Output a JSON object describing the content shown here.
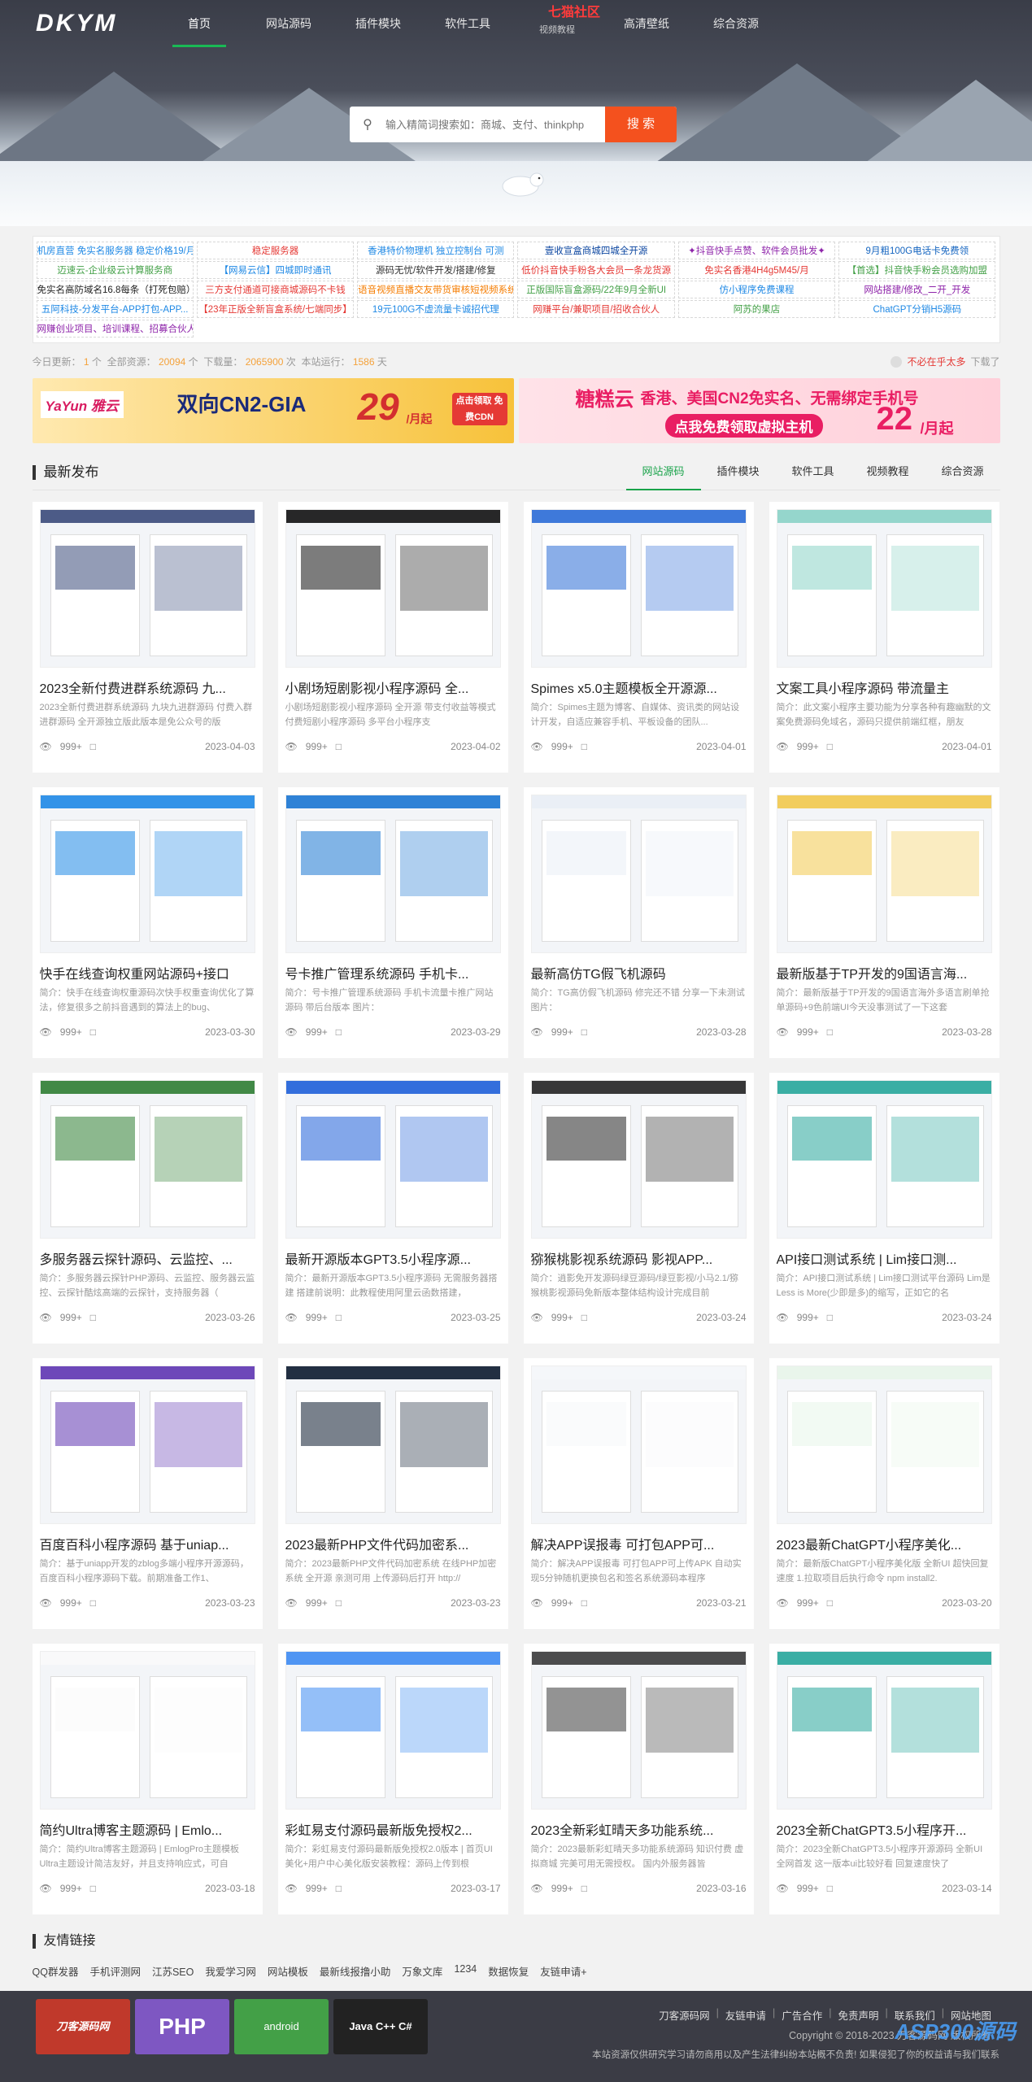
{
  "site": {
    "logo": "DKYM",
    "nav": [
      "首页",
      "网站源码",
      "插件模块",
      "软件工具",
      "视频教程",
      "高清壁纸",
      "综合资源"
    ],
    "nav_badge": "七猫社区",
    "search_placeholder": "输入精简词搜索如：商城、支付、thinkphp",
    "search_button": "搜 索"
  },
  "ads": [
    {
      "text": "机房直营 免实名服务器 稳定价格19/月",
      "color": "#1e88e5"
    },
    {
      "text": "稳定服务器",
      "color": "#e53935"
    },
    {
      "text": "香港特价物理机 独立控制台 可测",
      "color": "#1e88e5"
    },
    {
      "text": "壹收宣盒商城四城全开源",
      "color": "#0d47a1"
    },
    {
      "text": "✦抖音快手点赞、软件会员批发✦",
      "color": "#8e24aa"
    },
    {
      "text": "9月粗100G电话卡免费领",
      "color": "#1565c0"
    },
    {
      "text": "迈速云-企业级云计算服务商",
      "color": "#43a047"
    },
    {
      "text": "【网易云信】四城即时通讯",
      "color": "#1e88e5"
    },
    {
      "text": "源码无忧/软件开发/搭建/修复",
      "color": "#333333"
    },
    {
      "text": "低价抖音快手粉各大会员一条龙货源",
      "color": "#e53935"
    },
    {
      "text": "免实名香港4H4g5M45/月",
      "color": "#e53935"
    },
    {
      "text": "【首选】抖音快手粉会员选购加盟",
      "color": "#43a047"
    },
    {
      "text": "免实名高防域名16.8每条（打死包赔）",
      "color": "#222222"
    },
    {
      "text": "三方支付通道可接商城源码不卡钱",
      "color": "#e53935"
    },
    {
      "text": "语音视频直播交友带货审核短视频系统",
      "color": "#f57c00"
    },
    {
      "text": "正版国际盲盒源码/22年9月全新UI",
      "color": "#43a047"
    },
    {
      "text": "仿小程序免费课程",
      "color": "#1e88e5"
    },
    {
      "text": "网站搭建/修改_二开_开发",
      "color": "#8e24aa"
    },
    {
      "text": "五阿科技-分发平台-APP打包-APP...",
      "color": "#1e88e5"
    },
    {
      "text": "【23年正版全新盲盒系统/七端同步】",
      "color": "#e53935"
    },
    {
      "text": "19元100G不虚流量卡诚招代理",
      "color": "#1e88e5"
    },
    {
      "text": "网赚平台/兼职项目/招收合伙人",
      "color": "#e53935"
    },
    {
      "text": "阿苏的果店",
      "color": "#43a047"
    },
    {
      "text": "ChatGPT分销H5源码",
      "color": "#1e88e5"
    },
    {
      "text": "网赚创业项目、培训课程、招募合伙人",
      "color": "#8e24aa"
    }
  ],
  "stats": {
    "today_label": "今日更新：",
    "today": "1",
    "total_label": "全部资源：",
    "total": "20094",
    "downloads_label": "下载量：",
    "downloads": "2065900",
    "days_label": "本站运行：",
    "days": "1586",
    "unit_ge": "个",
    "unit_ci": "次",
    "unit_tian": "天",
    "right_text": "不必在乎太多",
    "right_suffix": "下载了"
  },
  "banners": {
    "b1_brand": "YaYun 雅云",
    "b1_title": "双向CN2-GIA",
    "b1_price": "29",
    "b1_unit": "/月起",
    "b1_tag": "点击领取 免费CDN",
    "b2_brand": "糖糕云",
    "b2_title": "香港、美国CN2免实名、无需绑定手机号",
    "b2_sub": "点我免费领取虚拟主机",
    "b2_price": "22",
    "b2_unit": "/月起"
  },
  "section": {
    "title": "最新发布",
    "tabs": [
      "网站源码",
      "插件模块",
      "软件工具",
      "视频教程",
      "综合资源"
    ]
  },
  "cards": [
    {
      "title": "2023全新付费进群系统源码 九...",
      "desc": "2023全新付费进群系统源码 九块九进群源码 付费入群进群源码 全开源独立版此版本是免公众号的版",
      "views": "999+",
      "date": "2023-04-03",
      "theme": "#3a4a7a"
    },
    {
      "title": "小剧场短剧影视小程序源码 全...",
      "desc": "小剧场短剧影视小程序源码 全开源 带支付收益等模式 付费短剧小程序源码 多平台小程序支",
      "views": "999+",
      "date": "2023-04-02",
      "theme": "#111111"
    },
    {
      "title": "Spimes x5.0主题模板全开源源...",
      "desc": "简介：Spimes主题为博客、自媒体、资讯类的网站设计开发，自适应兼容手机、平板设备的团队...",
      "views": "999+",
      "date": "2023-04-01",
      "theme": "#2a6bd6"
    },
    {
      "title": "文案工具小程序源码 带流量主",
      "desc": "简介：此文案小程序主要功能为分享各种有趣幽默的文案免费源码免域名，源码只提供前端红框，朋友",
      "views": "999+",
      "date": "2023-04-01",
      "theme": "#8bd3c7"
    },
    {
      "title": "快手在线查询权重网站源码+接口",
      "desc": "简介：快手在线查询权重源码次快手权重查询优化了算法，修复很多之前抖音遇到的算法上的bug、",
      "views": "999+",
      "date": "2023-03-30",
      "theme": "#1e88e5"
    },
    {
      "title": "号卡推广管理系统源码 手机卡...",
      "desc": "简介：号卡推广管理系统源码 手机卡流量卡推广网站源码 带后台版本 图片：",
      "views": "999+",
      "date": "2023-03-29",
      "theme": "#1976d2"
    },
    {
      "title": "最新高仿TG假飞机源码",
      "desc": "简介：TG高仿假飞机源码 修完还不错 分享一下未测试图片：",
      "views": "999+",
      "date": "2023-03-28",
      "theme": "#e9eef5"
    },
    {
      "title": "最新版基于TP开发的9国语言海...",
      "desc": "简介：最新版基于TP开发的9国语言海外多语言刷单抢单源码+9色前端UI今天没事测试了一下这套",
      "views": "999+",
      "date": "2023-03-28",
      "theme": "#f2c94c"
    },
    {
      "title": "多服务器云探针源码、云监控、...",
      "desc": "简介：多服务器云探针PHP源码、云监控、服务器云监控、云探针酷炫高端的云探针，支持服务器（",
      "views": "999+",
      "date": "2023-03-26",
      "theme": "#2e7d32"
    },
    {
      "title": "最新开源版本GPT3.5小程序源...",
      "desc": "简介：最新开源版本GPT3.5小程序源码 无需服务器搭建 搭建前说明：此教程使用阿里云函数搭建，",
      "views": "999+",
      "date": "2023-03-25",
      "theme": "#1e5fd8"
    },
    {
      "title": "猕猴桃影视系统源码 影视APP...",
      "desc": "简介：逍影免开发源码绿豆源码/绿豆影视/小马2.1/猕猴桃影视源码免新版本整体结构设计完成目前",
      "views": "999+",
      "date": "2023-03-24",
      "theme": "#222222"
    },
    {
      "title": "API接口测试系统 | Lim接口测...",
      "desc": "简介：API接口测试系统 | Lim接口测试平台源码 Lim是Less is More(少即是多)的缩写，正如它的名",
      "views": "999+",
      "date": "2023-03-24",
      "theme": "#26a69a"
    },
    {
      "title": "百度百科小程序源码 基于uniap...",
      "desc": "简介：基于uniapp开发的zblog多端小程序开源源码，百度百科小程序源码下载。前期准备工作1、",
      "views": "999+",
      "date": "2023-03-23",
      "theme": "#5e35b1"
    },
    {
      "title": "2023最新PHP文件代码加密系...",
      "desc": "简介：2023最新PHP文件代码加密系统 在线PHP加密系统 全开源 亲测可用 上传源码后打开 http://",
      "views": "999+",
      "date": "2023-03-23",
      "theme": "#0b1a2e"
    },
    {
      "title": "解决APP误报毒 可打包APP可...",
      "desc": "简介：解决APP误报毒 可打包APP可上传APK 自动实现5分钟随机更换包名和签名系统源码本程序",
      "views": "999+",
      "date": "2023-03-21",
      "theme": "#f5f7fa"
    },
    {
      "title": "2023最新ChatGPT小程序美化...",
      "desc": "简介：最新版ChatGPT小程序美化版 全新UI 超快回复速度 1.拉取项目后执行命令 npm install2.",
      "views": "999+",
      "date": "2023-03-20",
      "theme": "#e8f5e9"
    },
    {
      "title": "简约Ultra博客主题源码 | Emlo...",
      "desc": "简介：简约Ultra博客主题源码 | EmlogPro主题模板Ultra主题设计简洁友好，并且支持响应式，可自",
      "views": "999+",
      "date": "2023-03-18",
      "theme": "#fafafa"
    },
    {
      "title": "彩虹易支付源码最新版免授权2...",
      "desc": "简介：彩虹易支付源码最新版免授权2.0版本 | 首页UI美化+用户中心美化版安装教程：源码上传到根",
      "views": "999+",
      "date": "2023-03-17",
      "theme": "#3d8bf2"
    },
    {
      "title": "2023全新彩虹晴天多功能系统...",
      "desc": "简介：2023最新彩虹晴天多功能系统源码 知识付费 虚拟商城 完美可用无需授权。 国内外服务器皆",
      "views": "999+",
      "date": "2023-03-16",
      "theme": "#3a3a3a"
    },
    {
      "title": "2023全新ChatGPT3.5小程序开...",
      "desc": "简介：2023全新ChatGPT3.5小程序开源源码 全新UI 全网首发 这一版本ui比较好看 回复速度快了",
      "views": "999+",
      "date": "2023-03-14",
      "theme": "#26a69a"
    }
  ],
  "friends": {
    "title": "友情链接",
    "links": [
      "QQ群发器",
      "手机评测网",
      "江苏SEO",
      "我爱学习网",
      "网站模板",
      "最新线报撸小助",
      "万象文库",
      "1234",
      "数据恢复",
      "友链申请+"
    ]
  },
  "footer": {
    "logos": [
      "刀客源码网",
      "PHP",
      "android",
      "Java C++ C#"
    ],
    "nav": [
      "刀客源码网",
      "友链申请",
      "广告合作",
      "免责声明",
      "联系我们",
      "网站地图"
    ],
    "copyright": "Copyright © 2018-2023 刀客源码网 版权所有",
    "note": "本站资源仅供研究学习请勿商用以及产生法律纠纷本站概不负责! 如果侵犯了你的权益请与我们联系",
    "watermark": "ASP300源码"
  }
}
